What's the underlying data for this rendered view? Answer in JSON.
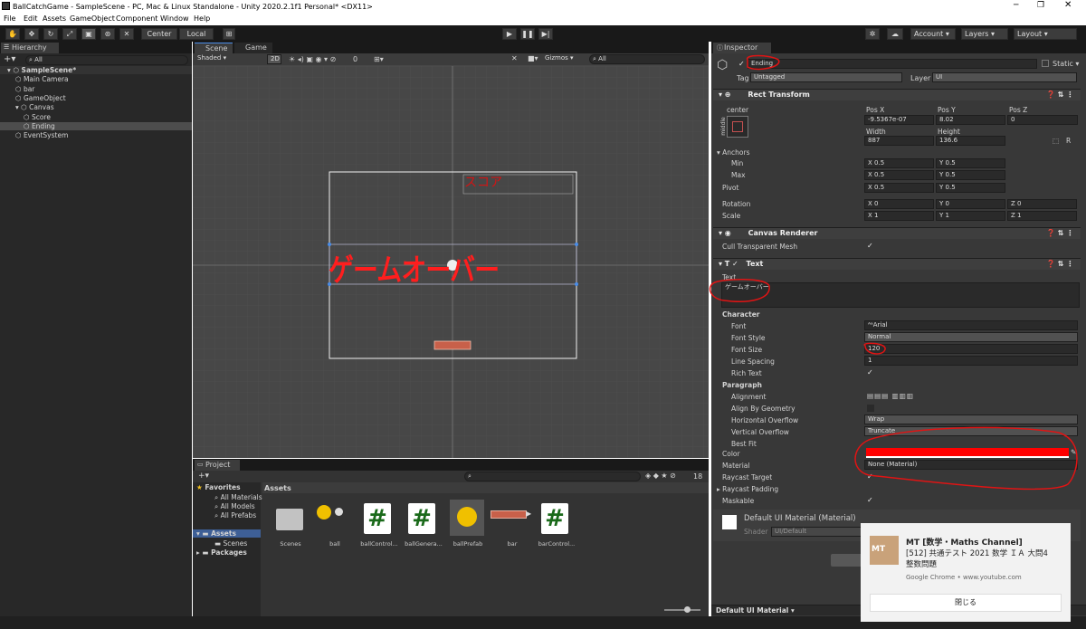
{
  "window": {
    "title": "BallCatchGame - SampleScene - PC, Mac & Linux Standalone - Unity 2020.2.1f1 Personal* <DX11>"
  },
  "menu": [
    "File",
    "Edit",
    "Assets",
    "GameObject",
    "Component",
    "Window",
    "Help"
  ],
  "toolbar": {
    "center": "Center",
    "local": "Local",
    "account": "Account",
    "layers": "Layers",
    "layout": "Layout"
  },
  "hierarchy": {
    "tab": "Hierarchy",
    "search": "All",
    "items": [
      {
        "label": "SampleScene*",
        "indent": 0
      },
      {
        "label": "Main Camera",
        "indent": 1
      },
      {
        "label": "bar",
        "indent": 1
      },
      {
        "label": "GameObject",
        "indent": 1
      },
      {
        "label": "Canvas",
        "indent": 1
      },
      {
        "label": "Score",
        "indent": 2
      },
      {
        "label": "Ending",
        "indent": 2
      },
      {
        "label": "EventSystem",
        "indent": 1
      }
    ]
  },
  "scene": {
    "tab_scene": "Scene",
    "tab_game": "Game",
    "shading": "Shaded",
    "mode2d": "2D",
    "hidden": "0",
    "gizmos": "Gizmos",
    "search": "All",
    "score_text": "スコア",
    "gameover_text": "ゲームオーバー"
  },
  "project": {
    "tab": "Project",
    "count": "18",
    "favorites": "Favorites",
    "fav_items": [
      "All Materials",
      "All Models",
      "All Prefabs"
    ],
    "assets_label": "Assets",
    "tree": [
      "Assets",
      "Scenes",
      "Packages"
    ],
    "assets": [
      {
        "name": "Scenes",
        "type": "folder"
      },
      {
        "name": "ball",
        "type": "material"
      },
      {
        "name": "ballControl...",
        "type": "script"
      },
      {
        "name": "ballGenera...",
        "type": "script"
      },
      {
        "name": "ballPrefab",
        "type": "prefab"
      },
      {
        "name": "bar",
        "type": "bar"
      },
      {
        "name": "barControl...",
        "type": "script"
      }
    ]
  },
  "inspector": {
    "tab": "Inspector",
    "name": "Ending",
    "static": "Static",
    "tag_label": "Tag",
    "tag": "Untagged",
    "layer_label": "Layer",
    "layer": "UI",
    "rect": {
      "title": "Rect Transform",
      "anchor": "center",
      "side": "middle",
      "posx_l": "Pos X",
      "posy_l": "Pos Y",
      "posz_l": "Pos Z",
      "posx": "-9.5367e-07",
      "posy": "8.02",
      "posz": "0",
      "width_l": "Width",
      "height_l": "Height",
      "width": "887",
      "height": "136.6",
      "r": "R",
      "anchors": "Anchors",
      "min": "Min",
      "max": "Max",
      "pivot": "Pivot",
      "rotation": "Rotation",
      "scale": "Scale",
      "min_x": "0.5",
      "min_y": "0.5",
      "max_x": "0.5",
      "max_y": "0.5",
      "piv_x": "0.5",
      "piv_y": "0.5",
      "rot_x": "0",
      "rot_y": "0",
      "rot_z": "0",
      "sc_x": "1",
      "sc_y": "1",
      "sc_z": "1"
    },
    "canvas_renderer": {
      "title": "Canvas Renderer",
      "cull": "Cull Transparent Mesh"
    },
    "text": {
      "title": "Text",
      "text_label": "Text",
      "value": "ゲームオーバー",
      "character": "Character",
      "font_l": "Font",
      "font": "Arial",
      "style_l": "Font Style",
      "style": "Normal",
      "size_l": "Font Size",
      "size": "120",
      "spacing_l": "Line Spacing",
      "spacing": "1",
      "rich": "Rich Text",
      "paragraph": "Paragraph",
      "align": "Alignment",
      "geom": "Align By Geometry",
      "hover_l": "Horizontal Overflow",
      "hover": "Wrap",
      "vover_l": "Vertical Overflow",
      "vover": "Truncate",
      "best": "Best Fit",
      "color_l": "Color",
      "color": "#ff0000",
      "material_l": "Material",
      "material": "None (Material)",
      "raycast": "Raycast Target",
      "padding": "Raycast Padding",
      "maskable": "Maskable"
    },
    "material": {
      "name": "Default UI Material (Material)",
      "shader_l": "Shader",
      "shader": "UI/Default",
      "bottom": "Default UI Material ▾"
    }
  },
  "notification": {
    "title": "MT [数学・Maths Channel]",
    "line1": "[512] 共通テスト 2021 数学 ＩＡ 大問4",
    "line2": "整数問題",
    "source": "Google Chrome • www.youtube.com",
    "close": "閉じる",
    "thumb": "MT"
  },
  "colors": {
    "accent": "#ff0000",
    "bg": "#282828"
  }
}
